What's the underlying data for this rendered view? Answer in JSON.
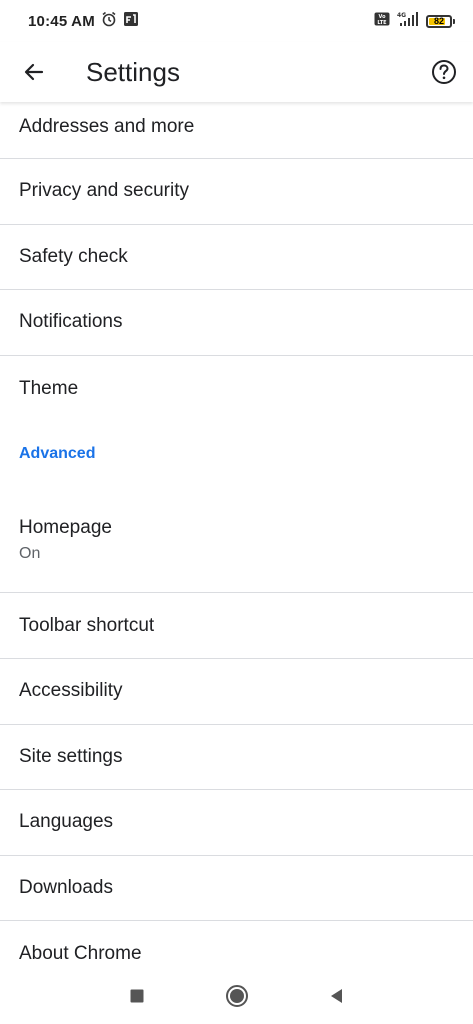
{
  "status_bar": {
    "time": "10:45 AM",
    "network": "4G",
    "volte": "Vo LTE",
    "battery_level": "82",
    "battery_color": "#f5c400",
    "icons": [
      "alarm-icon",
      "notification-app-icon",
      "volte-icon",
      "signal-icon",
      "battery-icon"
    ]
  },
  "app_bar": {
    "title": "Settings",
    "back_icon": "arrow-back-icon",
    "help_icon": "help-circle-icon"
  },
  "settings": {
    "items": [
      {
        "label": "Addresses and more"
      },
      {
        "label": "Privacy and security"
      },
      {
        "label": "Safety check"
      },
      {
        "label": "Notifications"
      },
      {
        "label": "Theme"
      }
    ],
    "advanced_header": "Advanced",
    "advanced_items": [
      {
        "label": "Homepage",
        "sub": "On"
      },
      {
        "label": "Toolbar shortcut"
      },
      {
        "label": "Accessibility"
      },
      {
        "label": "Site settings"
      },
      {
        "label": "Languages"
      },
      {
        "label": "Downloads"
      },
      {
        "label": "About Chrome"
      }
    ]
  },
  "nav_bar": {
    "icons": [
      "recents-square-icon",
      "home-circle-icon",
      "back-triangle-icon"
    ]
  },
  "colors": {
    "accent": "#1a73e8",
    "text": "#202124",
    "divider": "#dadce0"
  }
}
